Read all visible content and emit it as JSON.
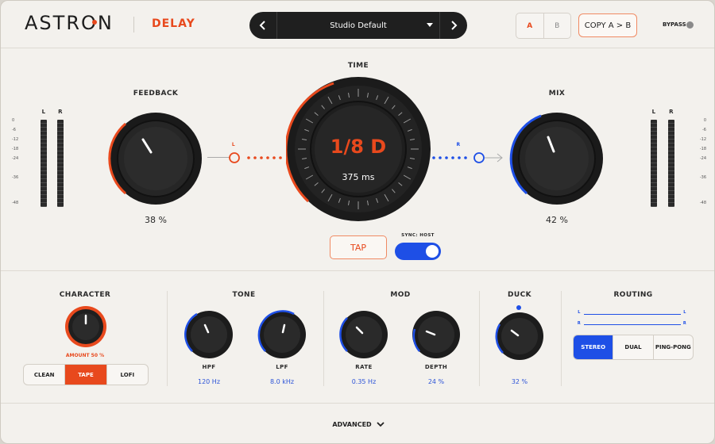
{
  "header": {
    "logo": "ASTRON",
    "product": "DELAY",
    "preset_name": "Studio Default",
    "ab_a": "A",
    "ab_b": "B",
    "copy_label": "COPY A > B",
    "bypass_label": "BYPASS"
  },
  "main": {
    "time_label": "TIME",
    "time_value": "1/8 D",
    "time_ms": "375 ms",
    "feedback_label": "FEEDBACK",
    "feedback_value": "38 %",
    "mix_label": "MIX",
    "mix_value": "42 %",
    "left_channel": "L",
    "right_channel": "R",
    "tap_label": "TAP",
    "sync_label": "SYNC: HOST",
    "meter_left": {
      "l": "L",
      "r": "R"
    },
    "meter_right": {
      "l": "L",
      "r": "R"
    },
    "meter_scale": [
      "0",
      "-6",
      "-12",
      "-18",
      "-24",
      "-36",
      "-48"
    ]
  },
  "bottom": {
    "character": {
      "label": "CHARACTER",
      "amount_label": "AMOUNT  50 %",
      "modes": [
        "CLEAN",
        "TAPE",
        "LOFI"
      ],
      "selected": "TAPE"
    },
    "tone": {
      "label": "TONE",
      "hpf_label": "HPF",
      "hpf_value": "120 Hz",
      "lpf_label": "LPF",
      "lpf_value": "8.0 kHz"
    },
    "mod": {
      "label": "MOD",
      "rate_label": "RATE",
      "rate_value": "0.35 Hz",
      "depth_label": "DEPTH",
      "depth_value": "24 %"
    },
    "duck": {
      "label": "DUCK",
      "value": "32 %"
    },
    "routing": {
      "label": "ROUTING",
      "l": "L",
      "r": "R",
      "modes": [
        "STEREO",
        "DUAL",
        "PING-PONG"
      ],
      "selected": "STEREO"
    }
  },
  "footer": {
    "advanced_label": "ADVANCED"
  },
  "colors": {
    "accent": "#e8491d",
    "blue": "#1e4fe6",
    "knob_dark": "#1f1f1f"
  }
}
